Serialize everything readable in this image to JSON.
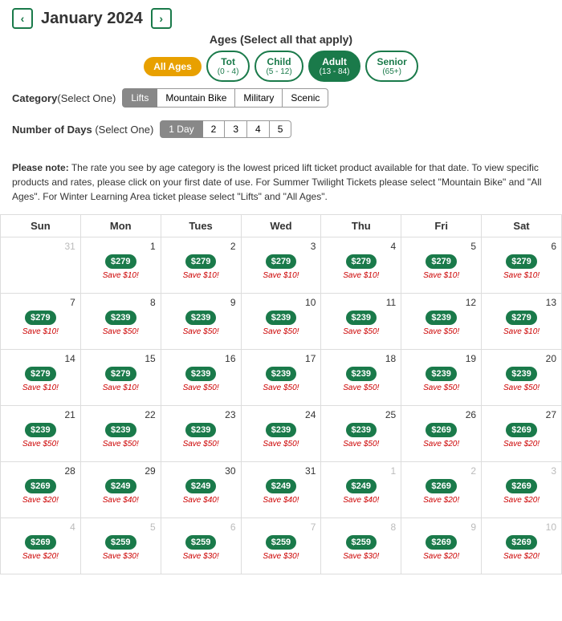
{
  "header": {
    "month": "January 2024",
    "prev_label": "‹",
    "next_label": "›"
  },
  "ages": {
    "label": "Ages (Select all that apply)",
    "buttons": [
      {
        "id": "all-ages",
        "label": "All Ages",
        "sub": "",
        "active": true
      },
      {
        "id": "tot",
        "label": "Tot",
        "sub": "(0 - 4)",
        "active": false
      },
      {
        "id": "child",
        "label": "Child",
        "sub": "(5 - 12)",
        "active": false
      },
      {
        "id": "adult",
        "label": "Adult",
        "sub": "(13 - 84)",
        "active": true
      },
      {
        "id": "senior",
        "label": "Senior",
        "sub": "(65+)",
        "active": false
      }
    ]
  },
  "category": {
    "label": "Category (Select One)",
    "buttons": [
      "Lifts",
      "Mountain Bike",
      "Military",
      "Scenic"
    ]
  },
  "days": {
    "label": "Number of Days (Select One)",
    "buttons": [
      "1 Day",
      "2",
      "3",
      "4",
      "5"
    ]
  },
  "notice": "Please note: The rate you see by age category is the lowest priced lift ticket product available for that date. To view specific products and rates, please click on your first date of use. For Summer Twilight Tickets please select \"Mountain Bike\" and \"All Ages\". For Winter Learning Area ticket please select \"Lifts\" and \"All Ages\".",
  "calendar": {
    "headers": [
      "Sun",
      "Mon",
      "Tues",
      "Wed",
      "Thu",
      "Fri",
      "Sat"
    ],
    "weeks": [
      [
        {
          "date": "31",
          "other": true,
          "price": null,
          "save": null
        },
        {
          "date": "1",
          "other": false,
          "price": "$279",
          "save": "Save $10!"
        },
        {
          "date": "2",
          "other": false,
          "price": "$279",
          "save": "Save $10!"
        },
        {
          "date": "3",
          "other": false,
          "price": "$279",
          "save": "Save $10!"
        },
        {
          "date": "4",
          "other": false,
          "price": "$279",
          "save": "Save $10!"
        },
        {
          "date": "5",
          "other": false,
          "price": "$279",
          "save": "Save $10!"
        },
        {
          "date": "6",
          "other": false,
          "price": "$279",
          "save": "Save $10!"
        }
      ],
      [
        {
          "date": "7",
          "other": false,
          "price": "$279",
          "save": "Save $10!"
        },
        {
          "date": "8",
          "other": false,
          "price": "$239",
          "save": "Save $50!"
        },
        {
          "date": "9",
          "other": false,
          "price": "$239",
          "save": "Save $50!"
        },
        {
          "date": "10",
          "other": false,
          "price": "$239",
          "save": "Save $50!"
        },
        {
          "date": "11",
          "other": false,
          "price": "$239",
          "save": "Save $50!"
        },
        {
          "date": "12",
          "other": false,
          "price": "$239",
          "save": "Save $50!"
        },
        {
          "date": "13",
          "other": false,
          "price": "$279",
          "save": "Save $10!"
        }
      ],
      [
        {
          "date": "14",
          "other": false,
          "price": "$279",
          "save": "Save $10!"
        },
        {
          "date": "15",
          "other": false,
          "price": "$279",
          "save": "Save $10!"
        },
        {
          "date": "16",
          "other": false,
          "price": "$239",
          "save": "Save $50!"
        },
        {
          "date": "17",
          "other": false,
          "price": "$239",
          "save": "Save $50!"
        },
        {
          "date": "18",
          "other": false,
          "price": "$239",
          "save": "Save $50!"
        },
        {
          "date": "19",
          "other": false,
          "price": "$239",
          "save": "Save $50!"
        },
        {
          "date": "20",
          "other": false,
          "price": "$239",
          "save": "Save $50!"
        }
      ],
      [
        {
          "date": "21",
          "other": false,
          "price": "$239",
          "save": "Save $50!"
        },
        {
          "date": "22",
          "other": false,
          "price": "$239",
          "save": "Save $50!"
        },
        {
          "date": "23",
          "other": false,
          "price": "$239",
          "save": "Save $50!"
        },
        {
          "date": "24",
          "other": false,
          "price": "$239",
          "save": "Save $50!"
        },
        {
          "date": "25",
          "other": false,
          "price": "$239",
          "save": "Save $50!"
        },
        {
          "date": "26",
          "other": false,
          "price": "$269",
          "save": "Save $20!"
        },
        {
          "date": "27",
          "other": false,
          "price": "$269",
          "save": "Save $20!"
        }
      ],
      [
        {
          "date": "28",
          "other": false,
          "price": "$269",
          "save": "Save $20!"
        },
        {
          "date": "29",
          "other": false,
          "price": "$249",
          "save": "Save $40!"
        },
        {
          "date": "30",
          "other": false,
          "price": "$249",
          "save": "Save $40!"
        },
        {
          "date": "31",
          "other": false,
          "price": "$249",
          "save": "Save $40!"
        },
        {
          "date": "1",
          "other": true,
          "price": "$249",
          "save": "Save $40!"
        },
        {
          "date": "2",
          "other": true,
          "price": "$269",
          "save": "Save $20!"
        },
        {
          "date": "3",
          "other": true,
          "price": "$269",
          "save": "Save $20!"
        }
      ],
      [
        {
          "date": "4",
          "other": true,
          "price": "$269",
          "save": "Save $20!"
        },
        {
          "date": "5",
          "other": true,
          "price": "$259",
          "save": "Save $30!"
        },
        {
          "date": "6",
          "other": true,
          "price": "$259",
          "save": "Save $30!"
        },
        {
          "date": "7",
          "other": true,
          "price": "$259",
          "save": "Save $30!"
        },
        {
          "date": "8",
          "other": true,
          "price": "$259",
          "save": "Save $30!"
        },
        {
          "date": "9",
          "other": true,
          "price": "$269",
          "save": "Save $20!"
        },
        {
          "date": "10",
          "other": true,
          "price": "$269",
          "save": "Save $20!"
        }
      ]
    ]
  }
}
